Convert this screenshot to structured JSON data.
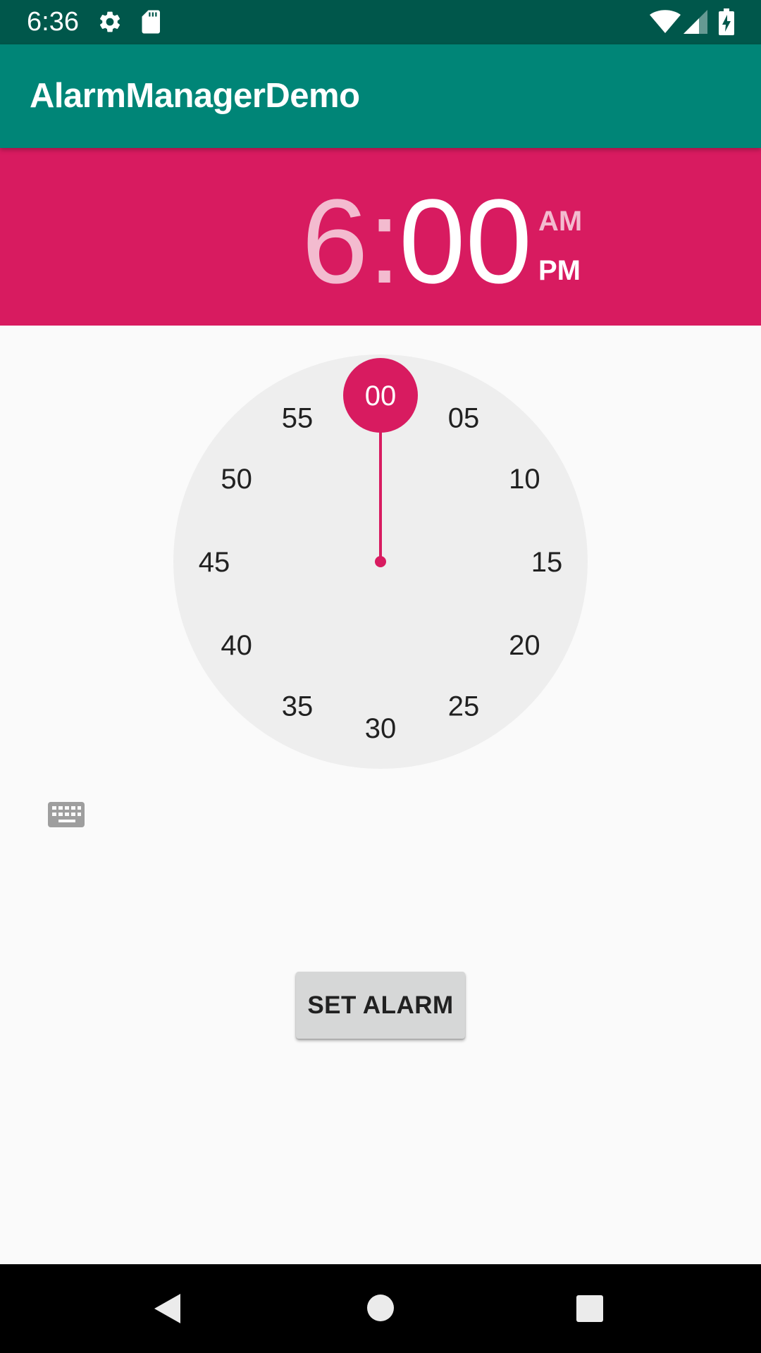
{
  "status_bar": {
    "time": "6:36",
    "icons": [
      "settings-gear-icon",
      "sd-card-icon",
      "wifi-icon",
      "cell-signal-icon",
      "battery-charging-icon"
    ]
  },
  "app_bar": {
    "title": "AlarmManagerDemo"
  },
  "time_picker": {
    "hour": "6",
    "separator": ":",
    "minute": "00",
    "am_label": "AM",
    "pm_label": "PM",
    "selected_period": "PM",
    "mode": "minutes",
    "dial_labels": [
      "00",
      "05",
      "10",
      "15",
      "20",
      "25",
      "30",
      "35",
      "40",
      "45",
      "50",
      "55"
    ],
    "selected_minute_index": 0,
    "keyboard_toggle_icon": "keyboard-icon"
  },
  "set_alarm_button": {
    "label": "SET ALARM"
  },
  "nav_bar": {
    "icons": [
      "back-icon",
      "home-icon",
      "recents-icon"
    ]
  },
  "colors": {
    "status_bar": "#00574b",
    "app_bar": "#008577",
    "accent": "#d81b60",
    "dial_face": "#eeeeee",
    "background": "#fafafa"
  }
}
